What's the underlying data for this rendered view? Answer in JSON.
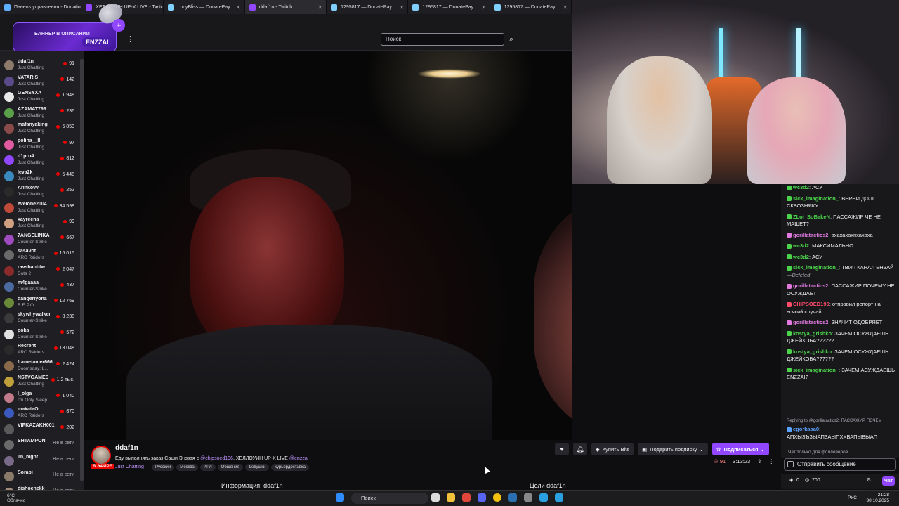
{
  "browser": {
    "tabs": [
      {
        "label": "Панель управления - Donatio",
        "color": "#5fb0ff",
        "active": false
      },
      {
        "label": "ХЕЛЛОУИН UP-X LIVE - Twitch",
        "color": "#9146ff",
        "active": false
      },
      {
        "label": "LucyBliss — DonatePay",
        "color": "#7fd0ff",
        "active": false
      },
      {
        "label": "ddaf1n - Twitch",
        "color": "#9146ff",
        "active": true
      },
      {
        "label": "1295817 — DonatePay",
        "color": "#7fd0ff",
        "active": false
      },
      {
        "label": "1295817 — DonatePay",
        "color": "#7fd0ff",
        "active": false
      },
      {
        "label": "1295817 — DonatePay",
        "color": "#7fd0ff",
        "active": false
      }
    ]
  },
  "banner": {
    "line1": "БАННЕР В ОПИСАНИИ",
    "line2": "ENZZAI"
  },
  "search": {
    "placeholder": "Поиск"
  },
  "sidebar": {
    "channels": [
      {
        "name": "ddaf1n",
        "category": "Just Chatting",
        "viewers": "91",
        "color": "#8c7a6a"
      },
      {
        "name": "VATARIS",
        "category": "Just Chatting",
        "viewers": "142",
        "color": "#5a4a8a"
      },
      {
        "name": "GENSYXA",
        "category": "Just Chatting",
        "viewers": "1 948",
        "color": "#e8e8e8"
      },
      {
        "name": "AZAMAT799",
        "category": "Just Chatting",
        "viewers": "236",
        "color": "#5aa04a"
      },
      {
        "name": "mafanyaking",
        "category": "Just Chatting",
        "viewers": "5 853",
        "color": "#8a4a4a"
      },
      {
        "name": "polina__ll",
        "category": "Just Chatting",
        "viewers": "97",
        "color": "#e05aa0"
      },
      {
        "name": "d1pro4",
        "category": "Just Chatting",
        "viewers": "812",
        "color": "#9146ff"
      },
      {
        "name": "leva2k",
        "category": "Just Chatting",
        "viewers": "5 448",
        "color": "#3a8ac0"
      },
      {
        "name": "Arinkovv",
        "category": "Just Chatting",
        "viewers": "252",
        "color": "#2a2a2a"
      },
      {
        "name": "evelone2004",
        "category": "Just Chatting",
        "viewers": "34 598",
        "color": "#c04a3a"
      },
      {
        "name": "xayreena",
        "category": "Just Chatting",
        "viewers": "99",
        "color": "#d0a080"
      },
      {
        "name": "7ANGELINKA",
        "category": "Counter-Strike",
        "viewers": "667",
        "color": "#a04ac0"
      },
      {
        "name": "sasavot",
        "category": "ARC Raiders",
        "viewers": "16 015",
        "color": "#6a6a6a"
      },
      {
        "name": "ravshanbtw",
        "category": "Dota 2",
        "viewers": "2 047",
        "color": "#8a2a2a"
      },
      {
        "name": "m4gaaaa",
        "category": "Counter-Strike",
        "viewers": "437",
        "color": "#4a6aa0"
      },
      {
        "name": "dangerlyoha",
        "category": "R.E.P.O.",
        "viewers": "12 769",
        "color": "#6a8a3a"
      },
      {
        "name": "skywhywalker",
        "category": "Counter-Strike",
        "viewers": "8 238",
        "color": "#3a3a3a"
      },
      {
        "name": "poka",
        "category": "Counter-Strike",
        "viewers": "572",
        "color": "#e0e0e0"
      },
      {
        "name": "Recrent",
        "category": "ARC Raiders",
        "viewers": "13 048",
        "color": "#2a2a2a"
      },
      {
        "name": "frametamer666",
        "category": "Doomsday: L...",
        "viewers": "2 424",
        "color": "#8a6a4a"
      },
      {
        "name": "NSTVGAMES",
        "category": "Just Chatting",
        "viewers": "1,2 тыс.",
        "color": "#c0a03a"
      },
      {
        "name": "l_olga",
        "category": "I'm Only Sleep...",
        "viewers": "1 040",
        "color": "#c07a8a"
      },
      {
        "name": "makataO",
        "category": "ARC Raiders",
        "viewers": "870",
        "color": "#3a5ac0"
      },
      {
        "name": "VIPKAZAKH001",
        "category": "",
        "viewers": "202",
        "color": "#5a5a5a"
      },
      {
        "name": "SHTAMPON",
        "category": "",
        "viewers": "Не в сети",
        "color": "#6a6a6a",
        "offline": true
      },
      {
        "name": "lin_night",
        "category": "",
        "viewers": "Не в сети",
        "color": "#7a6a8a",
        "offline": true
      },
      {
        "name": "Sorabi_",
        "category": "",
        "viewers": "Не в сети",
        "color": "#8a7a6a",
        "offline": true
      },
      {
        "name": "dishochekk",
        "category": "",
        "viewers": "Не в сети",
        "color": "#a08a7a",
        "offline": true
      }
    ]
  },
  "chat": {
    "messages": [
      {
        "user": "wc3d2",
        "color": "#4bd44b",
        "text": "АСУ"
      },
      {
        "user": "sick_imagination_",
        "color": "#4bd44b",
        "text": "ВЕРНИ ДОЛГ СКВОЗНЯКУ"
      },
      {
        "user": "ZLoi_SoBakeN",
        "color": "#4bd44b",
        "text": "ПАССАЖИР ЧЕ НЕ МАШЕТ?"
      },
      {
        "user": "gorillatactics2",
        "color": "#e07ae0",
        "text": "ахахахахпхахаха"
      },
      {
        "user": "wc3d2",
        "color": "#4bd44b",
        "text": "МАКСИМАЛЬНО"
      },
      {
        "user": "wc3d2",
        "color": "#4bd44b",
        "text": "АСУ"
      },
      {
        "user": "sick_imagination_",
        "color": "#4bd44b",
        "text": "ТВИЧ КАНАЛ ЕНЗАЙ",
        "deleted": "—Deleted"
      },
      {
        "user": "gorillatactics2",
        "color": "#e07ae0",
        "text": "ПАССАЖИР ПОЧЕМУ НЕ ОСУЖДАЕТ"
      },
      {
        "user": "CHIPSOED196",
        "color": "#ff4a6a",
        "text": "отправил репорт на всякий случай"
      },
      {
        "user": "gorillatactics2",
        "color": "#e07ae0",
        "text": "ЗНАЧИТ ОДОБРЯЕТ"
      },
      {
        "user": "kostya_grishko",
        "color": "#4bd44b",
        "text": "ЗАЧЕМ ОСУЖДАЕШЬ ДЖЕЙКОБА??????"
      },
      {
        "user": "kostya_grishko",
        "color": "#4bd44b",
        "text": "ЗАЧЕМ ОСУЖДАЕШЬ ДЖЕЙКОБА??????"
      },
      {
        "user": "sick_imagination_",
        "color": "#4bd44b",
        "text": "ЗАЧЕМ АСУЖДАЕШЬ ENZZAI?"
      },
      {
        "user": "egorkaaa0",
        "color": "#5aa0ff",
        "text": "АПХЫЗЪЗЫАПЗАЫПХХВАПЫВЫАП"
      }
    ],
    "reply_to": "Replying to @gorillatactics2: ПАССАЖИР ПОЧЕМ",
    "followers_only": "Чат только для фолловеров",
    "input_placeholder": "Отправить сообщение",
    "points_a": "0",
    "points_b": "700",
    "send_label": "Чат"
  },
  "stream": {
    "channel": "ddaf1n",
    "live_label": "В ЭФИРЕ",
    "title_text": "Еду выполнять заказ Саши Энззая с ",
    "mention1": "@chipsoed196",
    "title_mid": ". ХЕЛЛОУИН UP-X LIVE ",
    "mention2": "@enzzai",
    "category": "Just Chatting",
    "tags": [
      "Русский",
      "Москва",
      "ИРЛ",
      "Общение",
      "Девушки",
      "курьердоставка"
    ],
    "buy_bits": "Купить Bits",
    "gift_sub": "Подарить подписку",
    "subscribe": "Подписаться",
    "viewers": "91",
    "uptime": "3:13:23",
    "info_tab": "Информация: ddaf1n",
    "goals_tab": "Цели ddaf1n"
  },
  "taskbar": {
    "weather_temp": "6°C",
    "weather_desc": "Облачно",
    "search": "Поиск",
    "lang": "РУС",
    "time": "21:28",
    "date": "30.10.2025"
  }
}
